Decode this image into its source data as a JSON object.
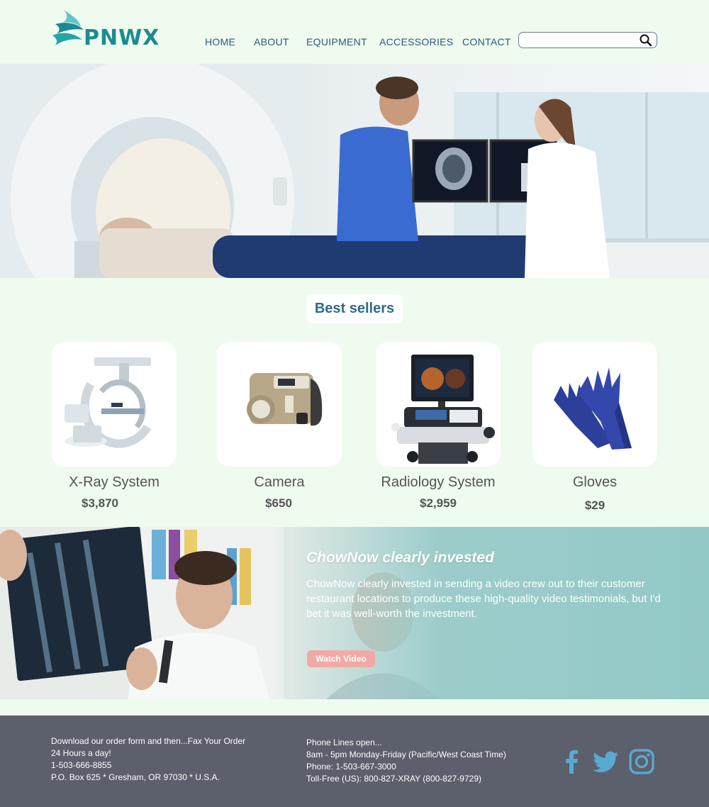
{
  "brand": {
    "name": "PNWX"
  },
  "nav": {
    "items": [
      {
        "label": "HOME"
      },
      {
        "label": "ABOUT"
      },
      {
        "label": "EQUIPMENT"
      },
      {
        "label": "ACCESSORIES"
      },
      {
        "label": "CONTACT"
      }
    ]
  },
  "search": {
    "placeholder": "",
    "value": "",
    "icon": "search-icon"
  },
  "best_sellers": {
    "title": "Best sellers",
    "products": [
      {
        "name": "X-Ray System",
        "price": "$3,870",
        "icon": "c-arm-xray-image"
      },
      {
        "name": "Camera",
        "price": "$650",
        "icon": "portable-xray-camera-image"
      },
      {
        "name": "Radiology System",
        "price": "$2,959",
        "icon": "ultrasound-system-image"
      },
      {
        "name": "Gloves",
        "price": "$29",
        "icon": "protective-gloves-image"
      }
    ]
  },
  "promo": {
    "title": "ChowNow  clearly invested",
    "body": "ChowNow  clearly invested in sending a video crew out to their customer restaurant locations to produce these high-quality video testimonials, but I'd bet it was well-worth the investment.",
    "button_label": "Watch Video"
  },
  "footer": {
    "left_lines": [
      "Download our order form and then...Fax Your Order",
      "24 Hours a day!",
      "1-503-666-8855",
      "P.O. Box 625 * Gresham, OR  97030 * U.S.A."
    ],
    "right_lines": [
      "Phone Lines open...",
      "8am - 5pm Monday-Friday (Pacific/West Coast Time)",
      "Phone: 1-503-667-3000",
      "Toll-Free (US): 800-827-XRAY (800-827-9729)"
    ],
    "social": [
      "facebook-icon",
      "twitter-icon",
      "instagram-icon"
    ]
  },
  "colors": {
    "page_bg": "#eefbee",
    "nav_text": "#2b5a7e",
    "brand_teal": "#1d8a92",
    "promo_teal": "#93c9c7",
    "button_pink": "#f2a9a6",
    "footer_bg": "#5c5f6c",
    "social_blue": "#5aa9cf"
  }
}
